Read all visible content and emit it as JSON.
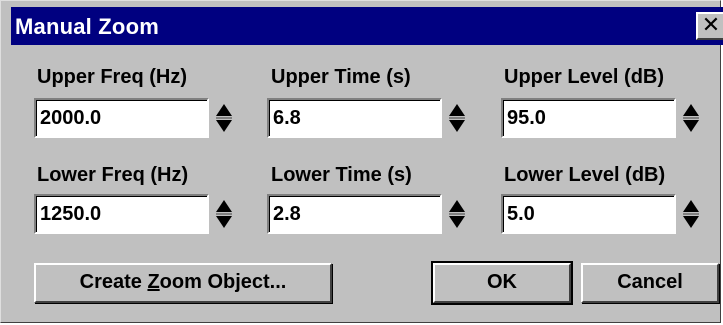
{
  "window": {
    "title": "Manual Zoom",
    "close_glyph": "✕"
  },
  "fields": {
    "upper_freq": {
      "label": "Upper Freq (Hz)",
      "value": "2000.0"
    },
    "upper_time": {
      "label": "Upper Time (s)",
      "value": "6.8"
    },
    "upper_level": {
      "label": "Upper Level (dB)",
      "value": "95.0"
    },
    "lower_freq": {
      "label": "Lower Freq (Hz)",
      "value": "1250.0"
    },
    "lower_time": {
      "label": "Lower Time (s)",
      "value": "2.8"
    },
    "lower_level": {
      "label": "Lower Level (dB)",
      "value": "5.0"
    }
  },
  "buttons": {
    "create_zoom_pre": "Create ",
    "create_zoom_mnemonic": "Z",
    "create_zoom_post": "oom Object...",
    "ok": "OK",
    "cancel": "Cancel"
  },
  "icons": {
    "spinner": "spinner-up-down-icon",
    "close": "close-icon"
  },
  "colors": {
    "titlebar": "#000080",
    "face": "#c0c0c0"
  }
}
